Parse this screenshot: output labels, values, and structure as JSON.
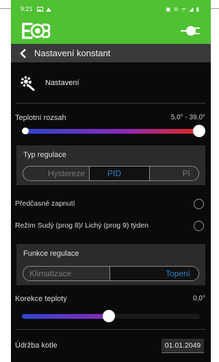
{
  "status_bar": {
    "time": "9:21",
    "left_icons": [
      "gallery-icon",
      "notification-icon"
    ],
    "right_icons_text": "▣ ⊜ ᯤ ◢ ▮"
  },
  "app_bar": {
    "logo_alt": "EOB logo",
    "plug_icon": "plug-icon"
  },
  "nav": {
    "back_icon": "chevron-left-icon",
    "title": "Nastavení konstant"
  },
  "section": {
    "icon": "gear-wrench-icon",
    "label": "Nastavení"
  },
  "temp_range": {
    "label": "Teplotní rozsah",
    "value": "5,0° - 39,0°",
    "low_fraction": 0.0,
    "high_fraction": 1.0
  },
  "regulation_type": {
    "title": "Typ regulace",
    "options": [
      "Hystereze",
      "PID",
      "PI"
    ],
    "selected": "PID"
  },
  "early_on": {
    "label": "Předčasné zapnutí",
    "checked": false
  },
  "even_odd": {
    "label": "Režim Sudý (prog 8)/ Lichý (prog 9) týden",
    "checked": false
  },
  "regulation_function": {
    "title": "Funkce regulace",
    "options": [
      "Klimatizace",
      "Topení"
    ],
    "selected": "Topení"
  },
  "temp_correction": {
    "label": "Korekce teploty",
    "value": "0,0°",
    "fraction": 0.5
  },
  "boiler_service": {
    "label": "Údržba kotle",
    "date": "01.01.2049"
  },
  "colors": {
    "brand_green": "#4fc132",
    "accent_blue": "#2f7fc9",
    "slider_gradient": [
      "#2e45c9",
      "#8a2ab8",
      "#e0281e"
    ]
  }
}
